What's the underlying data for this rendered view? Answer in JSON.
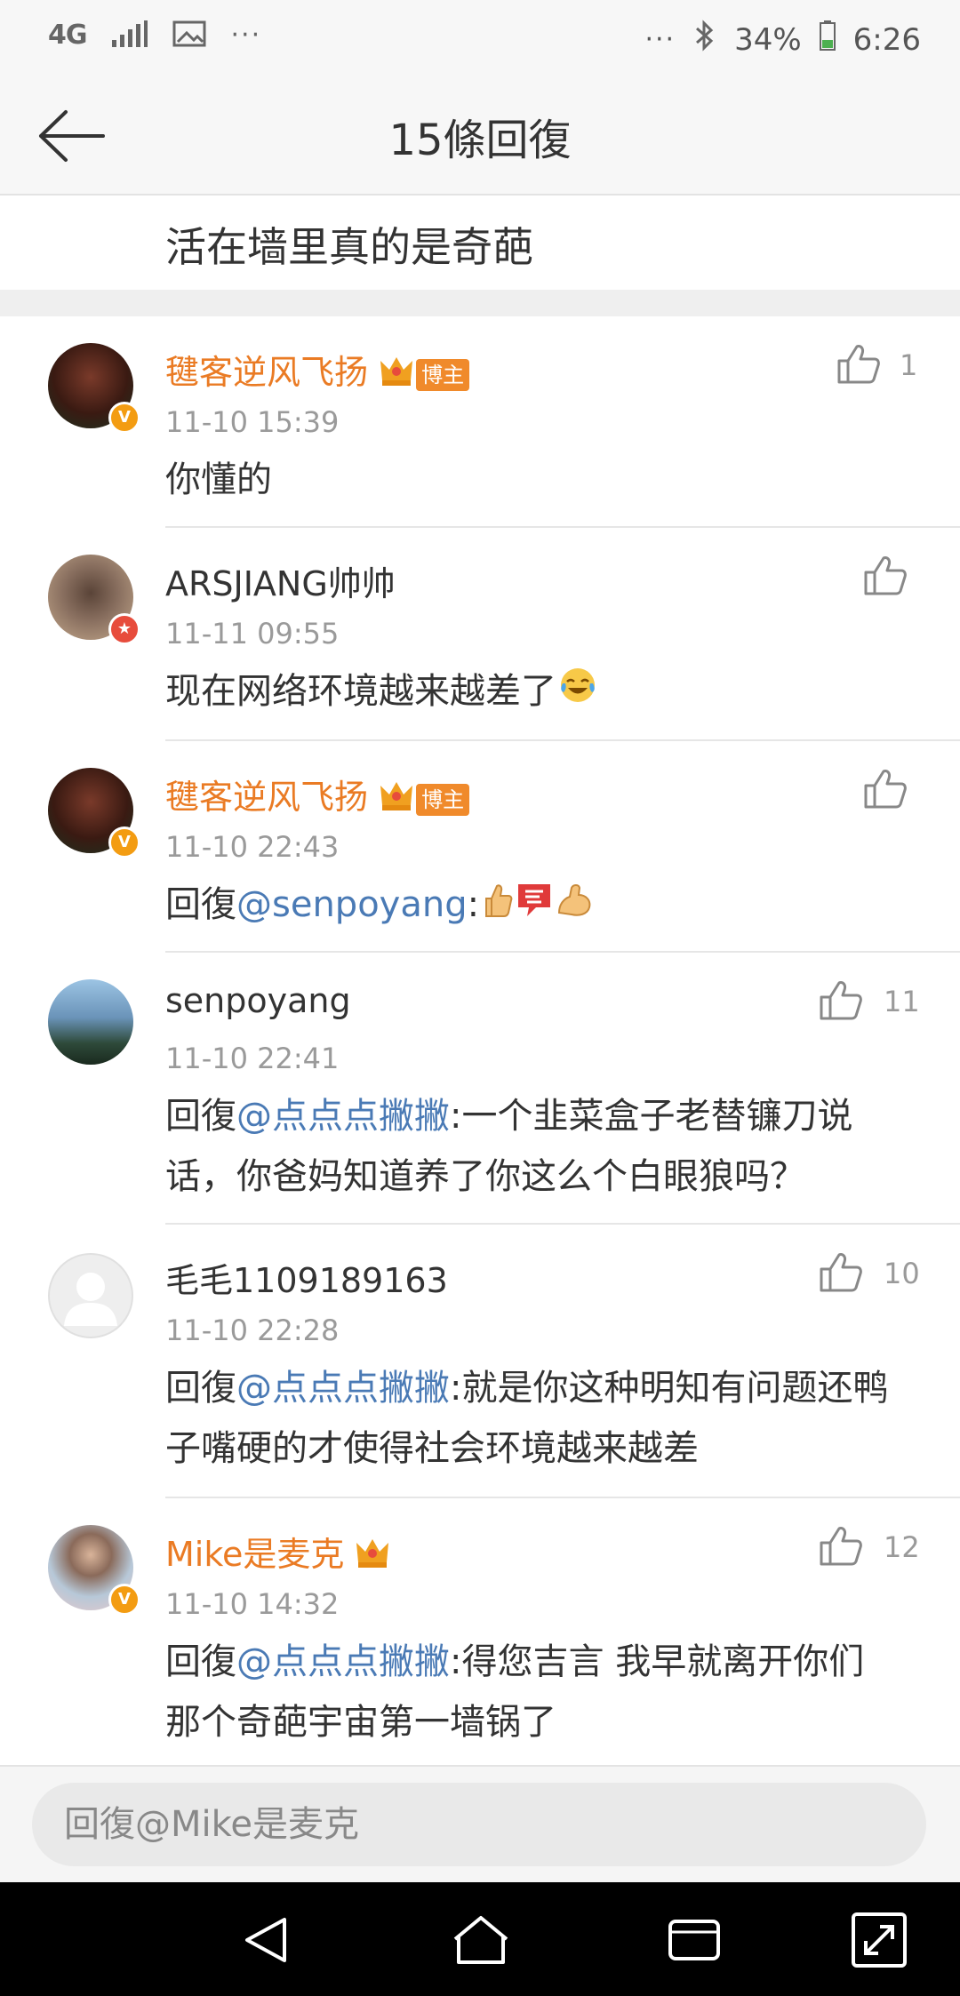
{
  "status_bar": {
    "network": "4G",
    "more_left": "···",
    "more_right": "···",
    "battery": "34%",
    "time": "6:26"
  },
  "header": {
    "title": "15條回復"
  },
  "post": {
    "text": "活在墙里真的是奇葩"
  },
  "comments": [
    {
      "username": "毽客逆风飞扬",
      "badge": "博主",
      "verified": "V",
      "time": "11-10 15:39",
      "likes": "1",
      "text": "你懂的"
    },
    {
      "username": "ARSJIANG帅帅",
      "verified": "★",
      "time": "11-11 09:55",
      "likes": "",
      "text": "现在网络环境越来越差了"
    },
    {
      "username": "毽客逆风飞扬",
      "badge": "博主",
      "verified": "V",
      "time": "11-10 22:43",
      "likes": "",
      "reply_prefix": "回復",
      "mention": "@senpoyang",
      "text": ":"
    },
    {
      "username": "senpoyang",
      "time": "11-10 22:41",
      "likes": "11",
      "reply_prefix": "回復",
      "mention": "@点点点撇撇",
      "text": ":一个韭菜盒子老替镰刀说话，你爸妈知道养了你这么个白眼狼吗？"
    },
    {
      "username": "毛毛1109189163",
      "time": "11-10 22:28",
      "likes": "10",
      "reply_prefix": "回復",
      "mention": "@点点点撇撇",
      "text": ":就是你这种明知有问题还鸭子嘴硬的才使得社会环境越来越差"
    },
    {
      "username": "Mike是麦克",
      "verified": "V",
      "time": "11-10 14:32",
      "likes": "12",
      "reply_prefix": "回復",
      "mention": "@点点点撇撇",
      "text": ":得您吉言 我早就离开你们那个奇葩宇宙第一墙锅了"
    }
  ],
  "reply_bar": {
    "placeholder": "回復@Mike是麦克"
  },
  "colors": {
    "orange_name": "#ea7b24",
    "mention": "#4a7ab5",
    "badge_orange": "#f08a2b",
    "verify_orange": "#f39c12",
    "verify_red": "#e74c3c"
  }
}
